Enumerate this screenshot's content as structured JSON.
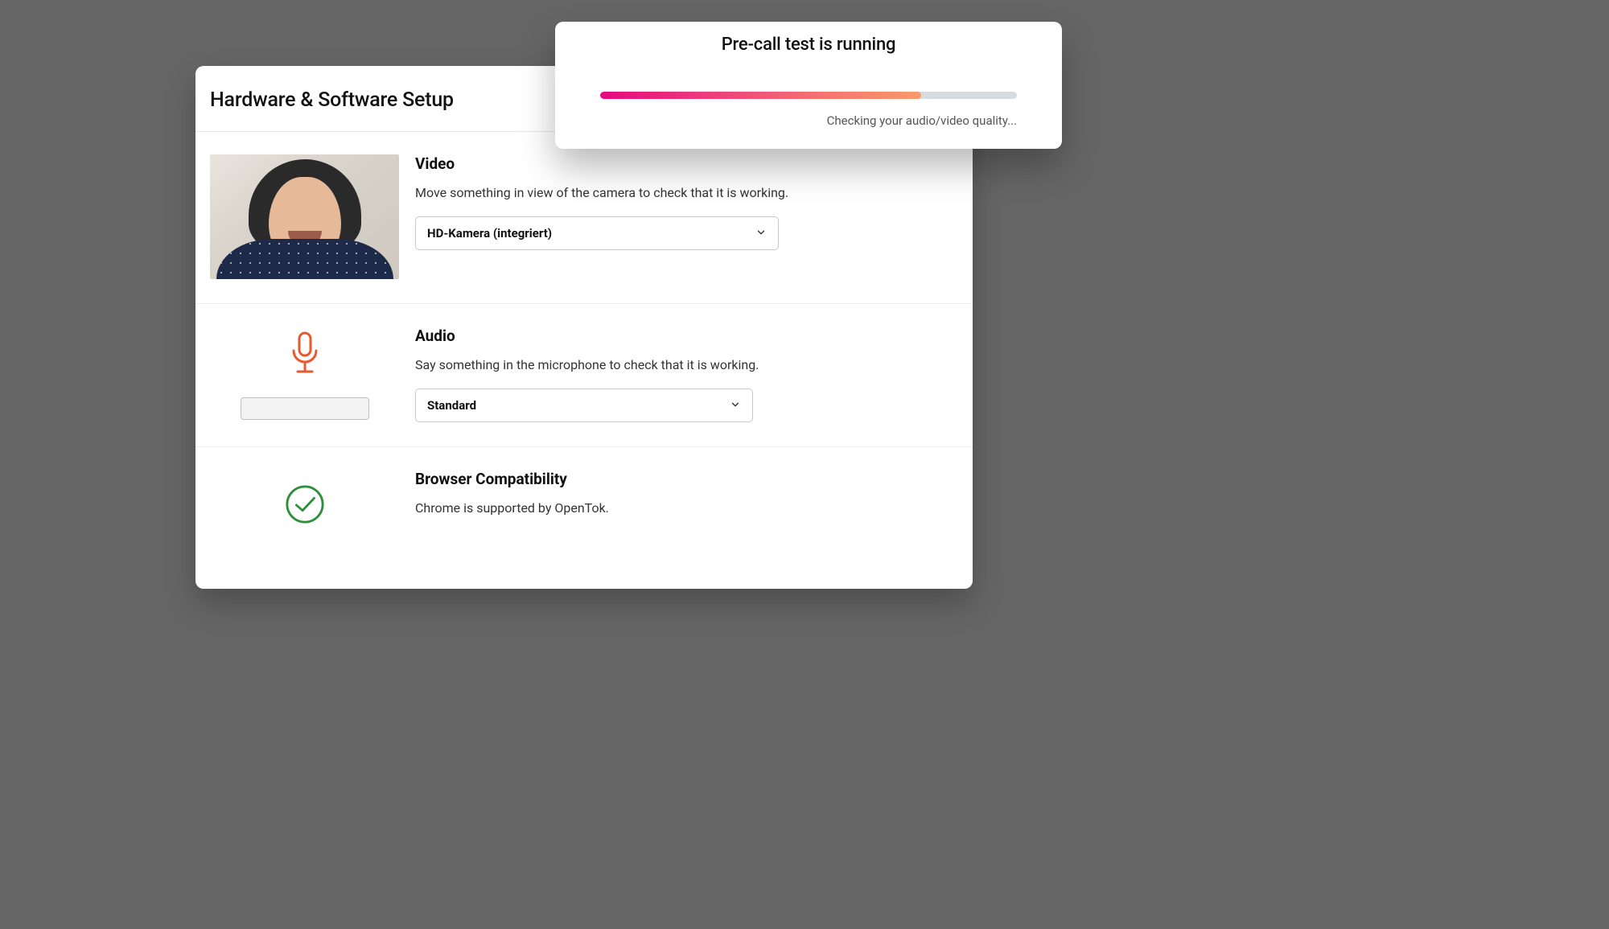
{
  "page": {
    "title": "Hardware & Software Setup"
  },
  "video": {
    "heading": "Video",
    "description": "Move something in view of the camera to check that it is working.",
    "selected_device": "HD-Kamera (integriert)"
  },
  "audio": {
    "heading": "Audio",
    "description": "Say something in the microphone to check that it is working.",
    "selected_device": "Standard"
  },
  "browser": {
    "heading": "Browser Compatibility",
    "description": "Chrome is supported by OpenTok."
  },
  "toast": {
    "title": "Pre-call test is running",
    "status": "Checking your audio/video quality...",
    "progress_percent": 77
  },
  "colors": {
    "accent_orange": "#e65a2e",
    "success_green": "#2f8f3d"
  }
}
